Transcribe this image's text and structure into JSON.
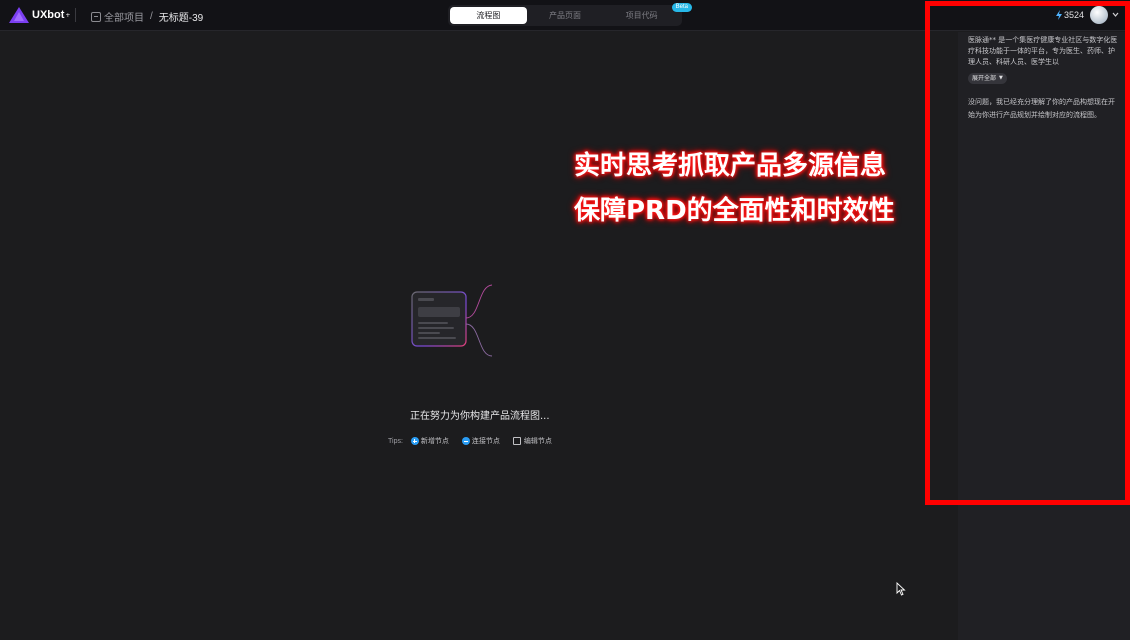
{
  "app": {
    "logo_text": "UXbot",
    "logo_sup": "+"
  },
  "breadcrumb": {
    "root": "全部项目",
    "separator": "/",
    "current": "无标题-39"
  },
  "tabs": [
    {
      "label": "流程图",
      "active": true
    },
    {
      "label": "产品页面",
      "active": false
    },
    {
      "label": "项目代码",
      "active": false,
      "badge": "Beta"
    }
  ],
  "header": {
    "credits": "3524"
  },
  "chat": {
    "message1": "医脉通** 是一个集医疗健康专业社区与数字化医疗科技功能于一体的平台，专为医生、药师、护理人员、科研人员、医学生以",
    "expand_label": "展开全部",
    "message2": "没问题，我已经充分理解了你的产品构想现在开始为你进行产品规划并绘制对应的流程图。"
  },
  "overlay": {
    "line1": "实时思考抓取产品多源信息",
    "line2": "保障PRD的全面性和时效性"
  },
  "canvas": {
    "loading_text": "正在努力为你构建产品流程图...",
    "tips_label": "Tips:",
    "tips": [
      "新增节点",
      "连接节点",
      "编辑节点"
    ]
  },
  "colors": {
    "accent": "#2a9df4",
    "highlight": "#ff0000",
    "beta": "#27b8e8"
  }
}
